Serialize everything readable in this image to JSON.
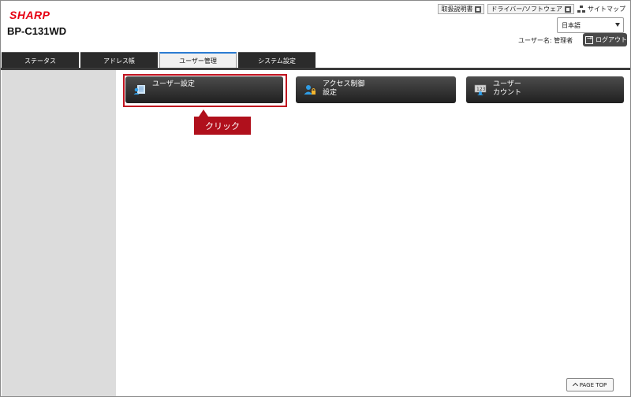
{
  "header": {
    "brand": "SHARP",
    "model": "BP-C131WD",
    "links": [
      {
        "label": "取扱説明書"
      },
      {
        "label": "ドライバー/ソフトウェア"
      }
    ],
    "sitemap_label": "サイトマップ",
    "language": "日本語",
    "user_label": "ユーザー名: 管理者",
    "logout_label": "ログアウト"
  },
  "tabs": [
    {
      "label": "ステータス",
      "active": false
    },
    {
      "label": "アドレス帳",
      "active": false
    },
    {
      "label": "ユーザー管理",
      "active": true
    },
    {
      "label": "システム設定",
      "active": false
    }
  ],
  "menu": [
    {
      "label": "ユーザー設定",
      "icon": "user-list-icon"
    },
    {
      "label": "アクセス制御\n設定",
      "icon": "user-lock-icon"
    },
    {
      "label": "ユーザー\nカウント",
      "icon": "counter-icon"
    }
  ],
  "annotation": {
    "label": "クリック",
    "color": "#b0101c"
  },
  "footer": {
    "page_top_label": "PAGE TOP"
  },
  "colors": {
    "brand": "#e60012",
    "tab_bg": "#2b2b2b",
    "active_tab_accent": "#2a7bd2"
  }
}
